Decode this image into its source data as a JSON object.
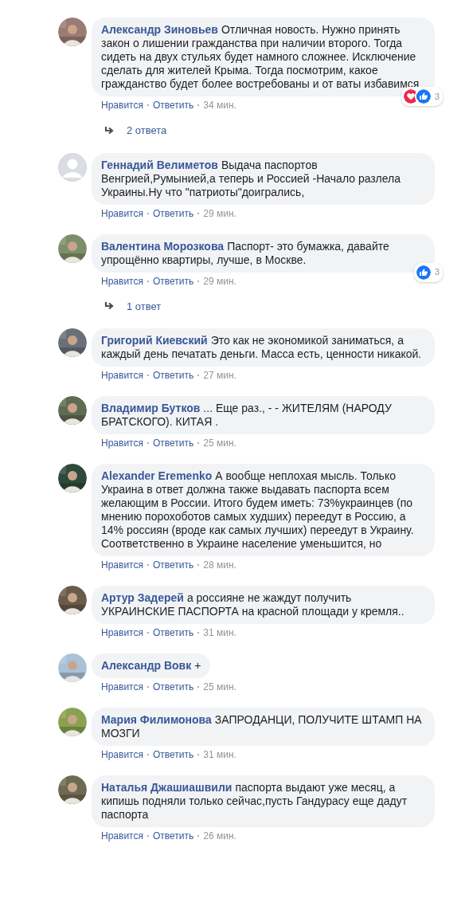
{
  "comments": [
    {
      "author": "Александр Зиновьев",
      "text": "Отличная новость. Нужно принять закон о лишении гражданства при наличии второго. Тогда сидеть на двух стульях будет намного сложнее. Исключение сделать для жителей Крыма. Тогда посмотрим, какое гражданство будет более востребованы и от ваты избавимся",
      "like": "Нравится",
      "reply": "Ответить",
      "time": "34 мин.",
      "reactions": {
        "icons": [
          {
            "kind": "love"
          },
          {
            "kind": "like"
          }
        ],
        "count": "3"
      },
      "replies": "2 ответа"
    },
    {
      "avatar": {
        "kind": "default"
      },
      "author": "Геннадий Велиметов",
      "text": "Выдача паспортов Венгрией,Румынией,а теперь и Россией -Начало разлела Украины.Ну что \"патриоты\"доигрались,",
      "like": "Нравится",
      "reply": "Ответить",
      "time": "29 мин."
    },
    {
      "author": "Валентина Морозкова",
      "text": "Паспорт- это бумажка, давайте упрощённо квартиры, лучше, в Москве.",
      "like": "Нравится",
      "reply": "Ответить",
      "time": "29 мин.",
      "reactions": {
        "icons": [
          {
            "kind": "like"
          }
        ],
        "count": "3"
      },
      "replies": "1 ответ"
    },
    {
      "author": "Григорий Киевский",
      "text": "Это как не экономикой заниматься, а каждый день печатать деньги. Масса есть, ценности никакой.",
      "like": "Нравится",
      "reply": "Ответить",
      "time": "27 мин."
    },
    {
      "author": "Владимир Бутков",
      "text": "... Еще раз., - - ЖИТЕЛЯМ (НАРОДУ БРАТСКОГО). КИТАЯ .",
      "like": "Нравится",
      "reply": "Ответить",
      "time": "25 мин."
    },
    {
      "author": "Alexander Eremenko",
      "text": "А вообще неплохая мысль. Только Украина в ответ должна также выдавать паспорта всем желающим в России. Итого будем иметь: 73%украинцев (по мнению порохоботов самых худших) переедут в Россию, а 14% россиян (вроде как самых лучших) переедут в Украину. Соответственно в Украине население уменьшится, но",
      "like": "Нравится",
      "reply": "Ответить",
      "time": "28 мин."
    },
    {
      "author": "Артур Задерей",
      "text": "а россияне не жаждут получить УКРАИНСКИЕ ПАСПОРТА на красной площади у кремля..",
      "like": "Нравится",
      "reply": "Ответить",
      "time": "31 мин."
    },
    {
      "author": "Александр Вовк",
      "text": "+",
      "like": "Нравится",
      "reply": "Ответить",
      "time": "25 мин."
    },
    {
      "author": "Мария Филимонова",
      "text": "ЗАПРОДАНЦИ, ПОЛУЧИТЕ ШТАМП НА МОЗГИ",
      "like": "Нравится",
      "reply": "Ответить",
      "time": "31 мин."
    },
    {
      "author": "Наталья Джашиашвили",
      "text": "паспорта выдают уже месяц, а кипишь подняли только сейчас,пусть Гандурасу еще дадут паспорта",
      "like": "Нравится",
      "reply": "Ответить",
      "time": "26 мин."
    }
  ]
}
